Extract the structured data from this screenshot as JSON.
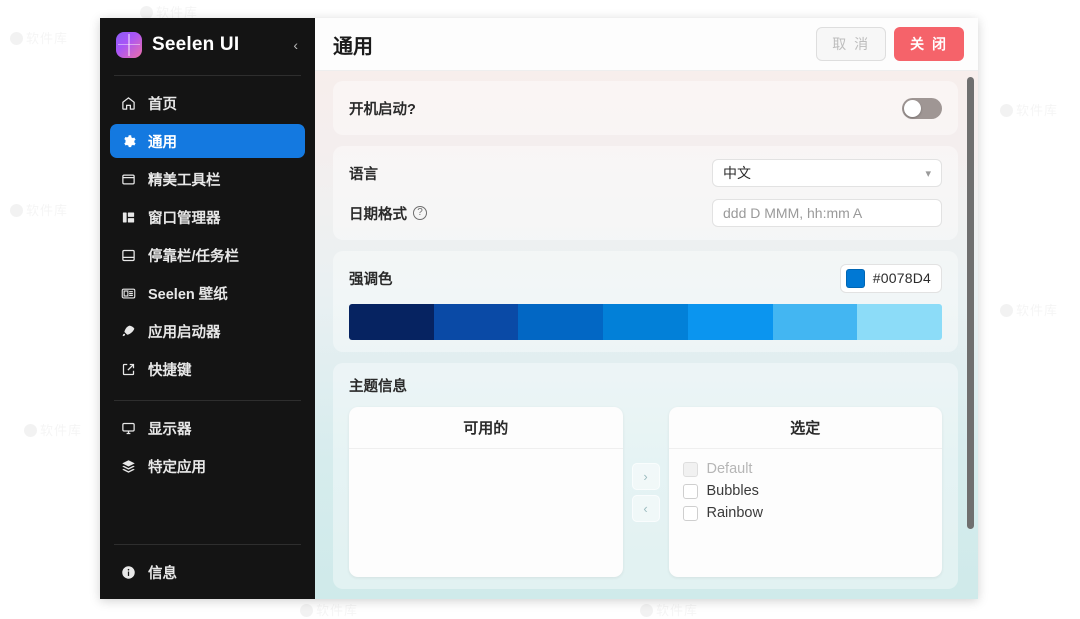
{
  "sidebar": {
    "brand": "Seelen UI",
    "collapse_icon": "chevron-left-icon",
    "items": [
      {
        "label": "首页",
        "icon": "home-icon",
        "active": false
      },
      {
        "label": "通用",
        "icon": "gear-icon",
        "active": true
      },
      {
        "label": "精美工具栏",
        "icon": "toolbar-icon",
        "active": false
      },
      {
        "label": "窗口管理器",
        "icon": "layout-icon",
        "active": false
      },
      {
        "label": "停靠栏/任务栏",
        "icon": "dock-icon",
        "active": false
      },
      {
        "label": "Seelen 壁纸",
        "icon": "wallpaper-icon",
        "active": false
      },
      {
        "label": "应用启动器",
        "icon": "rocket-icon",
        "active": false
      },
      {
        "label": "快捷键",
        "icon": "shortcut-icon",
        "active": false
      }
    ],
    "bottom_items": [
      {
        "label": "显示器",
        "icon": "monitor-icon"
      },
      {
        "label": "特定应用",
        "icon": "layers-icon"
      }
    ],
    "info_item": {
      "label": "信息",
      "icon": "info-icon"
    }
  },
  "titlebar": {
    "title": "通用",
    "cancel_label": "取 消",
    "close_label": "关 闭"
  },
  "settings": {
    "startup": {
      "label": "开机启动?",
      "toggle_on": false
    },
    "language": {
      "label": "语言",
      "value": "中文",
      "chevron_icon": "chevron-down-icon"
    },
    "date_format": {
      "label": "日期格式",
      "help_icon": "question-circle-icon",
      "value": "ddd D MMM, hh:mm A"
    },
    "accent": {
      "label": "强调色",
      "hex": "#0078D4",
      "palette": [
        "#062361",
        "#0A4AA6",
        "#0267C4",
        "#0280D8",
        "#0B95EF",
        "#43B6F2",
        "#8CDCF8"
      ]
    },
    "theme": {
      "label": "主题信息",
      "available_title": "可用的",
      "selected_title": "选定",
      "available_items": [],
      "selected_items": [
        {
          "label": "Default",
          "checked": false,
          "disabled": true
        },
        {
          "label": "Bubbles",
          "checked": false,
          "disabled": false
        },
        {
          "label": "Rainbow",
          "checked": false,
          "disabled": false
        }
      ],
      "move_right_icon": "chevron-right-icon",
      "move_left_icon": "chevron-left-icon"
    }
  },
  "watermarks": [
    "软件库",
    "软件库",
    "软件库",
    "软件库",
    "软件库",
    "软件库",
    "软件库",
    "软件库"
  ]
}
